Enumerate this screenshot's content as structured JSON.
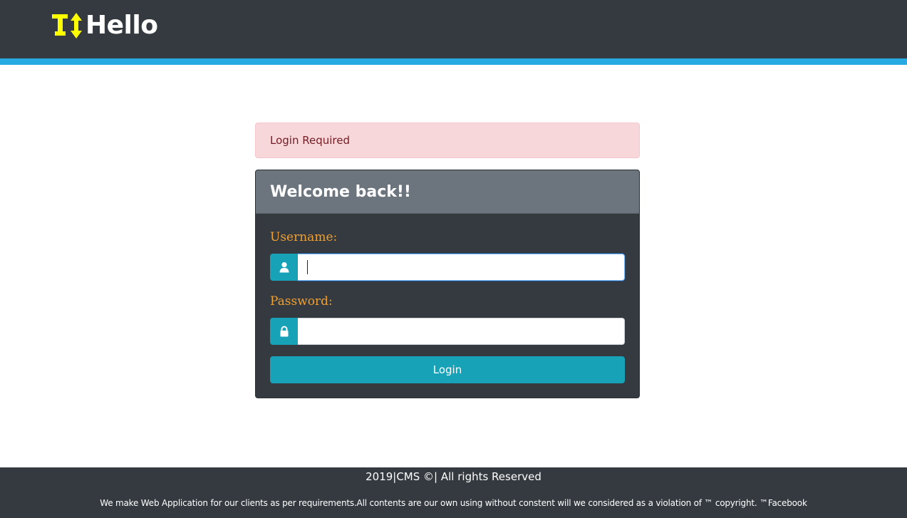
{
  "header": {
    "brand_text": "Hello",
    "brand_icon": "t-arrows-logo-icon",
    "background_color": "#343a40",
    "accent_strip_color": "#27aae1",
    "logo_color": "#ffff00"
  },
  "alert": {
    "message": "Login Required",
    "type": "danger"
  },
  "login_card": {
    "title": "Welcome back!!",
    "username": {
      "label": "Username:",
      "value": "",
      "placeholder": "",
      "icon": "user-icon"
    },
    "password": {
      "label": "Password:",
      "value": "",
      "placeholder": "",
      "icon": "lock-icon"
    },
    "submit_label": "Login",
    "accent_color": "#17a2b8",
    "label_color": "#f0a030"
  },
  "footer": {
    "copyright": "2019|CMS ©| All rights Reserved",
    "notice": "We make Web Application for our clients as per requirements.All contents are our own using without constent will we considered as a violation of ™ copyright. ™Facebook"
  }
}
